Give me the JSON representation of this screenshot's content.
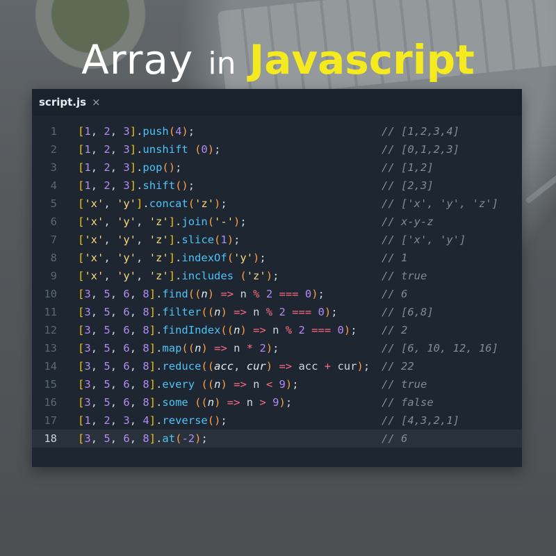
{
  "title": {
    "word1": "Array",
    "word2": "in",
    "word3": "Javascript"
  },
  "colors": {
    "title_accent": "#f5ea20",
    "editor_bg": "#1d2631",
    "comment": "#7f8b96",
    "number": "#b48cf0",
    "method": "#4fc3f7",
    "bracket": "#f1c40f"
  },
  "editor": {
    "tab": {
      "filename": "script.js",
      "close": "×"
    },
    "active_line": 18,
    "lines": [
      {
        "num": "1",
        "comment": "// [1,2,3,4]"
      },
      {
        "num": "2",
        "comment": "// [0,1,2,3]"
      },
      {
        "num": "3",
        "comment": "// [1,2]"
      },
      {
        "num": "4",
        "comment": "// [2,3]"
      },
      {
        "num": "5",
        "comment": "// ['x', 'y', 'z']"
      },
      {
        "num": "6",
        "comment": "// x-y-z"
      },
      {
        "num": "7",
        "comment": "// ['x', 'y']"
      },
      {
        "num": "8",
        "comment": "// 1"
      },
      {
        "num": "9",
        "comment": "// true"
      },
      {
        "num": "10",
        "comment": "// 6"
      },
      {
        "num": "11",
        "comment": "// [6,8]"
      },
      {
        "num": "12",
        "comment": "// 2"
      },
      {
        "num": "13",
        "comment": "// [6, 10, 12, 16]"
      },
      {
        "num": "14",
        "comment": "// 22"
      },
      {
        "num": "15",
        "comment": "// true"
      },
      {
        "num": "16",
        "comment": "// false"
      },
      {
        "num": "17",
        "comment": "// [4,3,2,1]"
      },
      {
        "num": "18",
        "comment": "// 6"
      }
    ],
    "statements": [
      [
        [
          "b",
          "["
        ],
        [
          "n",
          "1"
        ],
        [
          "p",
          ", "
        ],
        [
          "n",
          "2"
        ],
        [
          "p",
          ", "
        ],
        [
          "n",
          "3"
        ],
        [
          "b",
          "]"
        ],
        [
          "p",
          "."
        ],
        [
          "m",
          "push"
        ],
        [
          "par",
          "("
        ],
        [
          "n",
          "4"
        ],
        [
          "par",
          ")"
        ],
        [
          "p",
          ";"
        ]
      ],
      [
        [
          "b",
          "["
        ],
        [
          "n",
          "1"
        ],
        [
          "p",
          ", "
        ],
        [
          "n",
          "2"
        ],
        [
          "p",
          ", "
        ],
        [
          "n",
          "3"
        ],
        [
          "b",
          "]"
        ],
        [
          "p",
          "."
        ],
        [
          "m",
          "unshift"
        ],
        [
          "p",
          " "
        ],
        [
          "par",
          "("
        ],
        [
          "n",
          "0"
        ],
        [
          "par",
          ")"
        ],
        [
          "p",
          ";"
        ]
      ],
      [
        [
          "b",
          "["
        ],
        [
          "n",
          "1"
        ],
        [
          "p",
          ", "
        ],
        [
          "n",
          "2"
        ],
        [
          "p",
          ", "
        ],
        [
          "n",
          "3"
        ],
        [
          "b",
          "]"
        ],
        [
          "p",
          "."
        ],
        [
          "m",
          "pop"
        ],
        [
          "par",
          "()"
        ],
        [
          "p",
          ";"
        ]
      ],
      [
        [
          "b",
          "["
        ],
        [
          "n",
          "1"
        ],
        [
          "p",
          ", "
        ],
        [
          "n",
          "2"
        ],
        [
          "p",
          ", "
        ],
        [
          "n",
          "3"
        ],
        [
          "b",
          "]"
        ],
        [
          "p",
          "."
        ],
        [
          "m",
          "shift"
        ],
        [
          "par",
          "()"
        ],
        [
          "p",
          ";"
        ]
      ],
      [
        [
          "b",
          "["
        ],
        [
          "s",
          "'x'"
        ],
        [
          "p",
          ", "
        ],
        [
          "s",
          "'y'"
        ],
        [
          "b",
          "]"
        ],
        [
          "p",
          "."
        ],
        [
          "m",
          "concat"
        ],
        [
          "par",
          "("
        ],
        [
          "s",
          "'z'"
        ],
        [
          "par",
          ")"
        ],
        [
          "p",
          ";"
        ]
      ],
      [
        [
          "b",
          "["
        ],
        [
          "s",
          "'x'"
        ],
        [
          "p",
          ", "
        ],
        [
          "s",
          "'y'"
        ],
        [
          "p",
          ", "
        ],
        [
          "s",
          "'z'"
        ],
        [
          "b",
          "]"
        ],
        [
          "p",
          "."
        ],
        [
          "m",
          "join"
        ],
        [
          "par",
          "("
        ],
        [
          "s",
          "'-'"
        ],
        [
          "par",
          ")"
        ],
        [
          "p",
          ";"
        ]
      ],
      [
        [
          "b",
          "["
        ],
        [
          "s",
          "'x'"
        ],
        [
          "p",
          ", "
        ],
        [
          "s",
          "'y'"
        ],
        [
          "p",
          ", "
        ],
        [
          "s",
          "'z'"
        ],
        [
          "b",
          "]"
        ],
        [
          "p",
          "."
        ],
        [
          "m",
          "slice"
        ],
        [
          "par",
          "("
        ],
        [
          "n",
          "1"
        ],
        [
          "par",
          ")"
        ],
        [
          "p",
          ";"
        ]
      ],
      [
        [
          "b",
          "["
        ],
        [
          "s",
          "'x'"
        ],
        [
          "p",
          ", "
        ],
        [
          "s",
          "'y'"
        ],
        [
          "p",
          ", "
        ],
        [
          "s",
          "'z'"
        ],
        [
          "b",
          "]"
        ],
        [
          "p",
          "."
        ],
        [
          "m",
          "indexOf"
        ],
        [
          "par",
          "("
        ],
        [
          "s",
          "'y'"
        ],
        [
          "par",
          ")"
        ],
        [
          "p",
          ";"
        ]
      ],
      [
        [
          "b",
          "["
        ],
        [
          "s",
          "'x'"
        ],
        [
          "p",
          ", "
        ],
        [
          "s",
          "'y'"
        ],
        [
          "p",
          ", "
        ],
        [
          "s",
          "'z'"
        ],
        [
          "b",
          "]"
        ],
        [
          "p",
          "."
        ],
        [
          "m",
          "includes"
        ],
        [
          "p",
          " "
        ],
        [
          "par",
          "("
        ],
        [
          "s",
          "'z'"
        ],
        [
          "par",
          ")"
        ],
        [
          "p",
          ";"
        ]
      ],
      [
        [
          "b",
          "["
        ],
        [
          "n",
          "3"
        ],
        [
          "p",
          ", "
        ],
        [
          "n",
          "5"
        ],
        [
          "p",
          ", "
        ],
        [
          "n",
          "6"
        ],
        [
          "p",
          ", "
        ],
        [
          "n",
          "8"
        ],
        [
          "b",
          "]"
        ],
        [
          "p",
          "."
        ],
        [
          "m",
          "find"
        ],
        [
          "par",
          "(("
        ],
        [
          "arg",
          "n"
        ],
        [
          "par",
          ")"
        ],
        [
          "p",
          " "
        ],
        [
          "op",
          "=>"
        ],
        [
          "p",
          " n "
        ],
        [
          "op",
          "%"
        ],
        [
          "p",
          " "
        ],
        [
          "n",
          "2"
        ],
        [
          "p",
          " "
        ],
        [
          "op",
          "==="
        ],
        [
          "p",
          " "
        ],
        [
          "n",
          "0"
        ],
        [
          "par",
          ")"
        ],
        [
          "p",
          ";"
        ]
      ],
      [
        [
          "b",
          "["
        ],
        [
          "n",
          "3"
        ],
        [
          "p",
          ", "
        ],
        [
          "n",
          "5"
        ],
        [
          "p",
          ", "
        ],
        [
          "n",
          "6"
        ],
        [
          "p",
          ", "
        ],
        [
          "n",
          "8"
        ],
        [
          "b",
          "]"
        ],
        [
          "p",
          "."
        ],
        [
          "m",
          "filter"
        ],
        [
          "par",
          "(("
        ],
        [
          "arg",
          "n"
        ],
        [
          "par",
          ")"
        ],
        [
          "p",
          " "
        ],
        [
          "op",
          "=>"
        ],
        [
          "p",
          " n "
        ],
        [
          "op",
          "%"
        ],
        [
          "p",
          " "
        ],
        [
          "n",
          "2"
        ],
        [
          "p",
          " "
        ],
        [
          "op",
          "==="
        ],
        [
          "p",
          " "
        ],
        [
          "n",
          "0"
        ],
        [
          "par",
          ")"
        ],
        [
          "p",
          ";"
        ]
      ],
      [
        [
          "b",
          "["
        ],
        [
          "n",
          "3"
        ],
        [
          "p",
          ", "
        ],
        [
          "n",
          "5"
        ],
        [
          "p",
          ", "
        ],
        [
          "n",
          "6"
        ],
        [
          "p",
          ", "
        ],
        [
          "n",
          "8"
        ],
        [
          "b",
          "]"
        ],
        [
          "p",
          "."
        ],
        [
          "m",
          "findIndex"
        ],
        [
          "par",
          "(("
        ],
        [
          "arg",
          "n"
        ],
        [
          "par",
          ")"
        ],
        [
          "p",
          " "
        ],
        [
          "op",
          "=>"
        ],
        [
          "p",
          " n "
        ],
        [
          "op",
          "%"
        ],
        [
          "p",
          " "
        ],
        [
          "n",
          "2"
        ],
        [
          "p",
          " "
        ],
        [
          "op",
          "==="
        ],
        [
          "p",
          " "
        ],
        [
          "n",
          "0"
        ],
        [
          "par",
          ")"
        ],
        [
          "p",
          ";"
        ]
      ],
      [
        [
          "b",
          "["
        ],
        [
          "n",
          "3"
        ],
        [
          "p",
          ", "
        ],
        [
          "n",
          "5"
        ],
        [
          "p",
          ", "
        ],
        [
          "n",
          "6"
        ],
        [
          "p",
          ", "
        ],
        [
          "n",
          "8"
        ],
        [
          "b",
          "]"
        ],
        [
          "p",
          "."
        ],
        [
          "m",
          "map"
        ],
        [
          "par",
          "(("
        ],
        [
          "arg",
          "n"
        ],
        [
          "par",
          ")"
        ],
        [
          "p",
          " "
        ],
        [
          "op",
          "=>"
        ],
        [
          "p",
          " n "
        ],
        [
          "op",
          "*"
        ],
        [
          "p",
          " "
        ],
        [
          "n",
          "2"
        ],
        [
          "par",
          ")"
        ],
        [
          "p",
          ";"
        ]
      ],
      [
        [
          "b",
          "["
        ],
        [
          "n",
          "3"
        ],
        [
          "p",
          ", "
        ],
        [
          "n",
          "5"
        ],
        [
          "p",
          ", "
        ],
        [
          "n",
          "6"
        ],
        [
          "p",
          ", "
        ],
        [
          "n",
          "8"
        ],
        [
          "b",
          "]"
        ],
        [
          "p",
          "."
        ],
        [
          "m",
          "reduce"
        ],
        [
          "par",
          "(("
        ],
        [
          "arg",
          "acc"
        ],
        [
          "p",
          ", "
        ],
        [
          "arg",
          "cur"
        ],
        [
          "par",
          ")"
        ],
        [
          "p",
          " "
        ],
        [
          "op",
          "=>"
        ],
        [
          "p",
          " acc "
        ],
        [
          "op",
          "+"
        ],
        [
          "p",
          " cur"
        ],
        [
          "par",
          ")"
        ],
        [
          "p",
          ";"
        ]
      ],
      [
        [
          "b",
          "["
        ],
        [
          "n",
          "3"
        ],
        [
          "p",
          ", "
        ],
        [
          "n",
          "5"
        ],
        [
          "p",
          ", "
        ],
        [
          "n",
          "6"
        ],
        [
          "p",
          ", "
        ],
        [
          "n",
          "8"
        ],
        [
          "b",
          "]"
        ],
        [
          "p",
          "."
        ],
        [
          "m",
          "every"
        ],
        [
          "p",
          " "
        ],
        [
          "par",
          "(("
        ],
        [
          "arg",
          "n"
        ],
        [
          "par",
          ")"
        ],
        [
          "p",
          " "
        ],
        [
          "op",
          "=>"
        ],
        [
          "p",
          " n "
        ],
        [
          "op",
          "<"
        ],
        [
          "p",
          " "
        ],
        [
          "n",
          "9"
        ],
        [
          "par",
          ")"
        ],
        [
          "p",
          ";"
        ]
      ],
      [
        [
          "b",
          "["
        ],
        [
          "n",
          "3"
        ],
        [
          "p",
          ", "
        ],
        [
          "n",
          "5"
        ],
        [
          "p",
          ", "
        ],
        [
          "n",
          "6"
        ],
        [
          "p",
          ", "
        ],
        [
          "n",
          "8"
        ],
        [
          "b",
          "]"
        ],
        [
          "p",
          "."
        ],
        [
          "m",
          "some"
        ],
        [
          "p",
          " "
        ],
        [
          "par",
          "(("
        ],
        [
          "arg",
          "n"
        ],
        [
          "par",
          ")"
        ],
        [
          "p",
          " "
        ],
        [
          "op",
          "=>"
        ],
        [
          "p",
          " n "
        ],
        [
          "op",
          ">"
        ],
        [
          "p",
          " "
        ],
        [
          "n",
          "9"
        ],
        [
          "par",
          ")"
        ],
        [
          "p",
          ";"
        ]
      ],
      [
        [
          "b",
          "["
        ],
        [
          "n",
          "1"
        ],
        [
          "p",
          ", "
        ],
        [
          "n",
          "2"
        ],
        [
          "p",
          ", "
        ],
        [
          "n",
          "3"
        ],
        [
          "p",
          ", "
        ],
        [
          "n",
          "4"
        ],
        [
          "b",
          "]"
        ],
        [
          "p",
          "."
        ],
        [
          "m",
          "reverse"
        ],
        [
          "par",
          "()"
        ],
        [
          "p",
          ";"
        ]
      ],
      [
        [
          "b",
          "["
        ],
        [
          "n",
          "3"
        ],
        [
          "p",
          ", "
        ],
        [
          "n",
          "5"
        ],
        [
          "p",
          ", "
        ],
        [
          "n",
          "6"
        ],
        [
          "p",
          ", "
        ],
        [
          "n",
          "8"
        ],
        [
          "b",
          "]"
        ],
        [
          "p",
          "."
        ],
        [
          "m",
          "at"
        ],
        [
          "par",
          "("
        ],
        [
          "n",
          "-2"
        ],
        [
          "par",
          ")"
        ],
        [
          "p",
          ";"
        ]
      ]
    ]
  }
}
